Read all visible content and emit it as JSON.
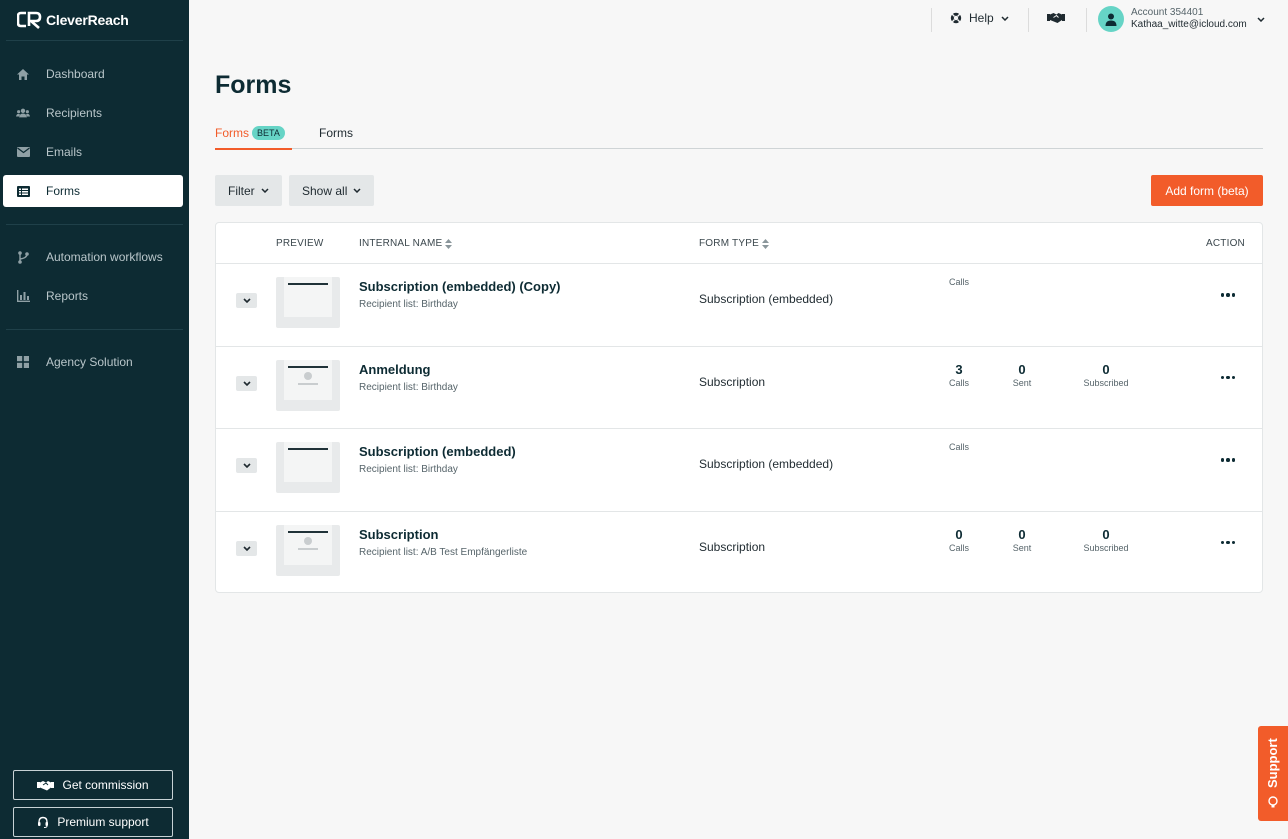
{
  "brand": {
    "name": "CleverReach",
    "accent": "#f25c2a",
    "sidebar_bg": "#0d2b33",
    "badge_color": "#66d4c6"
  },
  "sidebar": {
    "groups": [
      [
        {
          "label": "Dashboard",
          "icon": "home-icon"
        },
        {
          "label": "Recipients",
          "icon": "users-icon"
        },
        {
          "label": "Emails",
          "icon": "envelope-icon"
        },
        {
          "label": "Forms",
          "icon": "list-icon",
          "active": true
        }
      ],
      [
        {
          "label": "Automation workflows",
          "icon": "workflow-icon"
        },
        {
          "label": "Reports",
          "icon": "chart-icon"
        }
      ],
      [
        {
          "label": "Agency Solution",
          "icon": "grid-icon"
        }
      ]
    ],
    "commission_label": "Get commission",
    "premium_label": "Premium support"
  },
  "topbar": {
    "help_label": "Help",
    "account_line1": "Account 354401",
    "account_line2": "Kathaa_witte@icloud.com"
  },
  "page": {
    "title": "Forms",
    "tabs": [
      {
        "label": "Forms",
        "badge": "BETA",
        "active": true
      },
      {
        "label": "Forms"
      }
    ],
    "filter_label": "Filter",
    "show_all_label": "Show all",
    "add_button_label": "Add form (beta)"
  },
  "table": {
    "headers": {
      "preview": "PREVIEW",
      "internal_name": "INTERNAL NAME",
      "form_type": "FORM TYPE",
      "action": "ACTION"
    },
    "rows": [
      {
        "name": "Subscription (embedded) (Copy)",
        "list": "Recipient list: Birthday",
        "type": "Subscription (embedded)",
        "calls_label": "Calls"
      },
      {
        "name": "Anmeldung",
        "list": "Recipient list: Birthday",
        "type": "Subscription",
        "calls": "3",
        "calls_label": "Calls",
        "sent": "0",
        "sent_label": "Sent",
        "subscribed": "0",
        "subscribed_label": "Subscribed"
      },
      {
        "name": "Subscription (embedded)",
        "list": "Recipient list: Birthday",
        "type": "Subscription (embedded)",
        "calls_label": "Calls"
      },
      {
        "name": "Subscription",
        "list": "Recipient list: A/B Test Empfängerliste",
        "type": "Subscription",
        "calls": "0",
        "calls_label": "Calls",
        "sent": "0",
        "sent_label": "Sent",
        "subscribed": "0",
        "subscribed_label": "Subscribed"
      }
    ]
  },
  "support_label": "Support"
}
